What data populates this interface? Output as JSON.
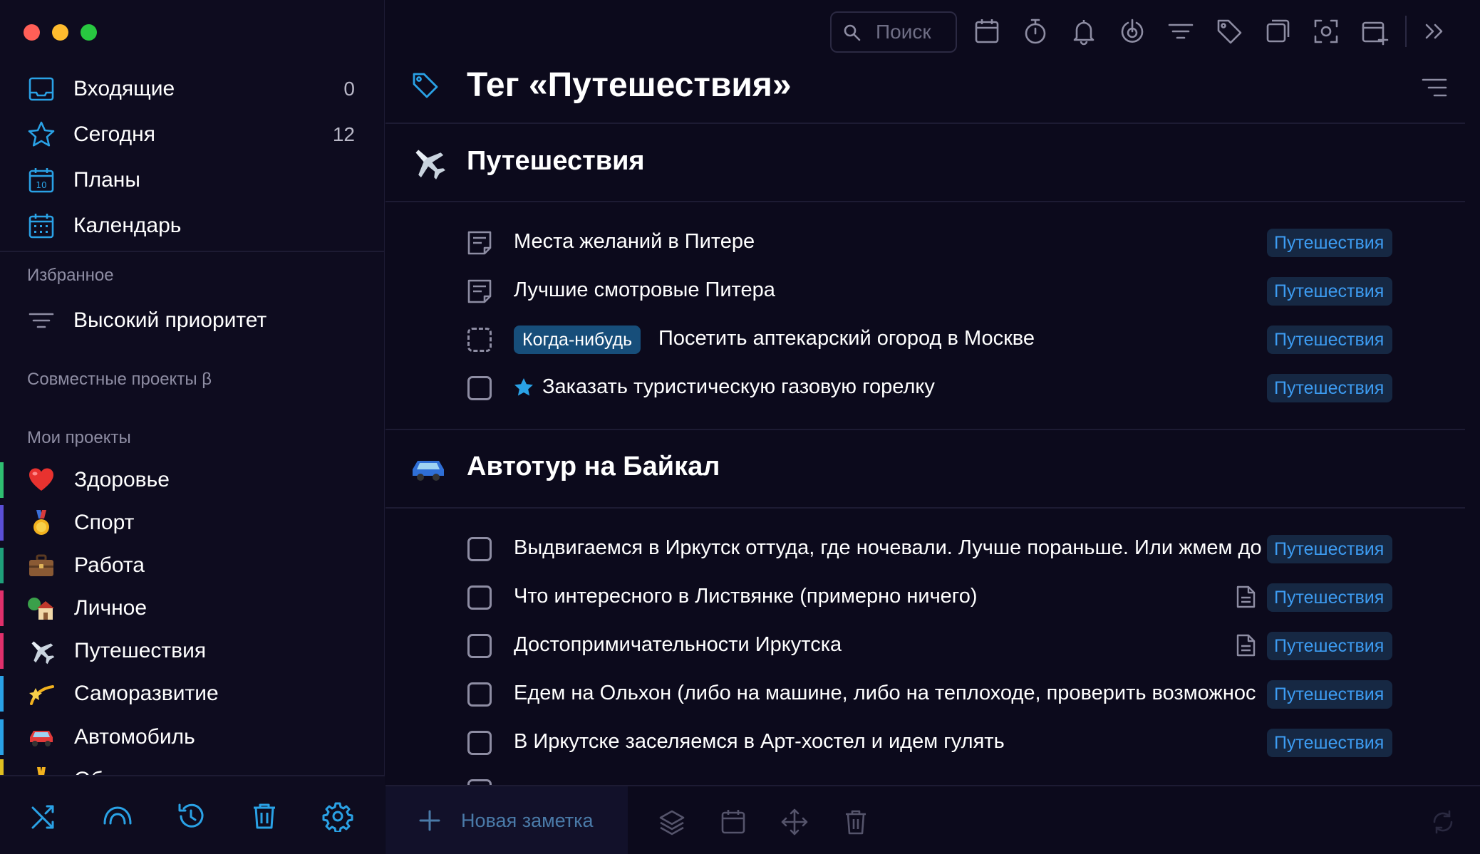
{
  "colors": {
    "accent": "#2aa2e6",
    "tag_text": "#3d9cf2",
    "tag_bg": "#162843",
    "when_bg": "#174e7a",
    "background": "#0c0a1c"
  },
  "sidebar": {
    "nav": [
      {
        "label": "Входящие",
        "count": "0",
        "icon": "inbox-icon"
      },
      {
        "label": "Сегодня",
        "count": "12",
        "icon": "star-icon"
      },
      {
        "label": "Планы",
        "count": "",
        "icon": "calendar-10-icon"
      },
      {
        "label": "Календарь",
        "count": "",
        "icon": "calendar-grid-icon"
      }
    ],
    "favorites_header": "Избранное",
    "favorites": [
      {
        "label": "Высокий приоритет",
        "icon": "filter-icon"
      }
    ],
    "shared_header": "Совместные проекты β",
    "projects_header": "Мои проекты",
    "projects": [
      {
        "label": "Здоровье",
        "icon": "heart-emoji-icon",
        "color": "#2fbf71"
      },
      {
        "label": "Спорт",
        "icon": "medal-emoji-icon",
        "color": "#5a4fd6"
      },
      {
        "label": "Работа",
        "icon": "briefcase-emoji-icon",
        "color": "#1fa07a"
      },
      {
        "label": "Личное",
        "icon": "house-emoji-icon",
        "color": "#e0306b"
      },
      {
        "label": "Путешествия",
        "icon": "airplane-emoji-icon",
        "color": "#e0306b"
      },
      {
        "label": "Саморазвитие",
        "icon": "dizzy-emoji-icon",
        "color": "#2aa2e6"
      },
      {
        "label": "Автомобиль",
        "icon": "car-emoji-icon",
        "color": "#2aa2e6"
      },
      {
        "label": "Об…",
        "icon": "partial-emoji-icon",
        "color": "#e0c020"
      }
    ]
  },
  "toolbar": {
    "search_placeholder": "Поиск"
  },
  "main": {
    "title": "Тег «Путешествия»",
    "sections": [
      {
        "title": "Путешествия",
        "icon": "airplane-emoji-icon",
        "tasks": [
          {
            "text": "Места желаний в Питере",
            "kind": "note",
            "tag": "Путешествия"
          },
          {
            "text": "Лучшие смотровые Питера",
            "kind": "note",
            "tag": "Путешествия"
          },
          {
            "text": "Посетить аптекарский огород в Москве",
            "kind": "someday",
            "when": "Когда-нибудь",
            "tag": "Путешествия"
          },
          {
            "text": "Заказать туристическую газовую горелку",
            "kind": "starred",
            "tag": "Путешествия"
          }
        ]
      },
      {
        "title": "Автотур на Байкал",
        "icon": "car-emoji-icon",
        "tasks": [
          {
            "text": "Выдвигаемся в Иркутск оттуда, где ночевали. Лучше пораньше. Или жмем до",
            "kind": "task",
            "tag": "Путешествия"
          },
          {
            "text": "Что интересного в Листвянке (примерно ничего)",
            "kind": "task",
            "has_note": true,
            "tag": "Путешествия"
          },
          {
            "text": "Достопримичательности Иркутска",
            "kind": "task",
            "has_note": true,
            "tag": "Путешествия"
          },
          {
            "text": "Едем на Ольхон (либо на машине, либо на теплоходе, проверить возможнос",
            "kind": "task",
            "tag": "Путешествия"
          },
          {
            "text": "В Иркутске заселяемся в Арт-хостел и идем гулять",
            "kind": "task",
            "tag": "Путешествия"
          }
        ]
      }
    ]
  },
  "bottom": {
    "new_note_label": "Новая заметка"
  }
}
